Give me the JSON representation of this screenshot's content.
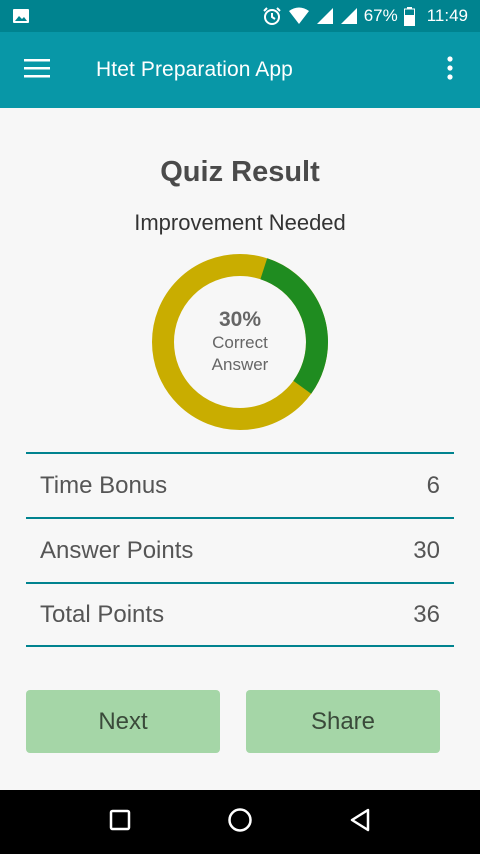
{
  "status_bar": {
    "battery": "67%",
    "time": "11:49"
  },
  "app_bar": {
    "title": "Htet Preparation App"
  },
  "quiz": {
    "title": "Quiz Result",
    "subtitle": "Improvement Needed",
    "correct_percent": 30,
    "correct_percent_label": "30%",
    "center_label": "Correct Answer"
  },
  "stats": [
    {
      "label": "Time Bonus",
      "value": "6"
    },
    {
      "label": "Answer Points",
      "value": "30"
    },
    {
      "label": "Total Points",
      "value": "36"
    }
  ],
  "buttons": {
    "next": "Next",
    "share": "Share"
  },
  "colors": {
    "primary": "#0897a7",
    "primary_dark": "#00838f",
    "correct": "#1f8c20",
    "incorrect": "#c9ad00",
    "button": "#a5d6a7"
  }
}
